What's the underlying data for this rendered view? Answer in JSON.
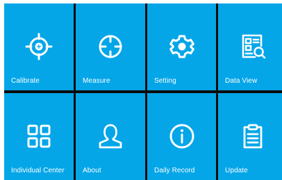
{
  "colors": {
    "tile_bg": "#04a6e8",
    "divider": "#0b0b0b",
    "icon": "#ffffff",
    "label": "#ffffff"
  },
  "tiles": [
    {
      "label": "Calibrate",
      "icon": "crosshair-target-icon"
    },
    {
      "label": "Measure",
      "icon": "crosshair-icon"
    },
    {
      "label": "Setting",
      "icon": "gear-icon"
    },
    {
      "label": "Data View",
      "icon": "document-search-icon"
    },
    {
      "label": "Individual Center",
      "icon": "grid-icon"
    },
    {
      "label": "About",
      "icon": "person-icon"
    },
    {
      "label": "Daily Record",
      "icon": "info-icon"
    },
    {
      "label": "Update",
      "icon": "clipboard-icon"
    }
  ]
}
